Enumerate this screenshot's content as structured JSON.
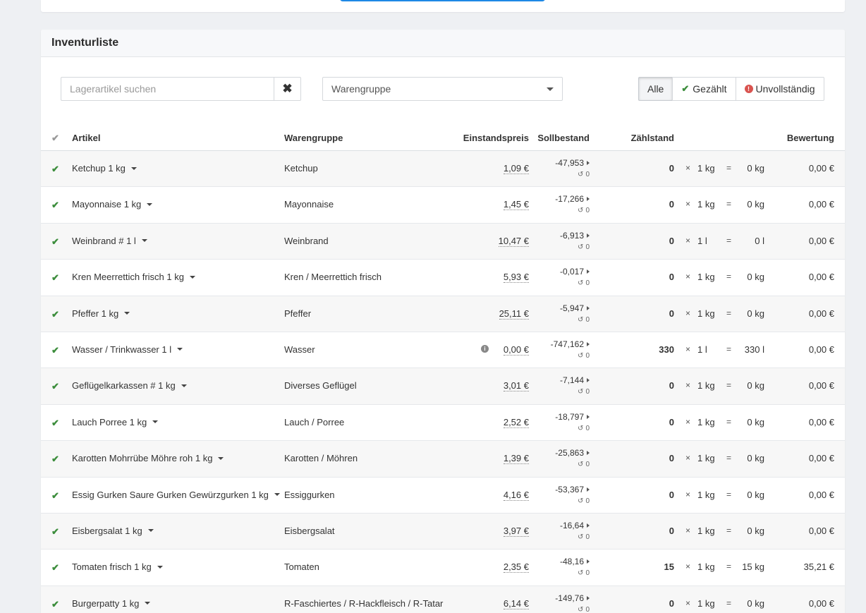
{
  "panel": {
    "title": "Inventurliste"
  },
  "search": {
    "placeholder": "Lagerartikel suchen",
    "value": ""
  },
  "group_select": {
    "label": "Warengruppe"
  },
  "filters": {
    "all": "Alle",
    "counted": "Gezählt",
    "incomplete": "Unvollständig",
    "active": "Alle"
  },
  "columns": {
    "article": "Artikel",
    "group": "Warengruppe",
    "price": "Einstandspreis",
    "target": "Sollbestand",
    "count": "Zählstand",
    "value": "Bewertung"
  },
  "rows": [
    {
      "article": "Ketchup 1 kg",
      "group": "Ketchup",
      "price": "1,09 €",
      "info": false,
      "target": "-47,953",
      "history": "0",
      "count": "0",
      "times": "×",
      "unit": "1 kg",
      "eq": "=",
      "total": "0 kg",
      "value": "0,00 €"
    },
    {
      "article": "Mayonnaise 1 kg",
      "group": "Mayonnaise",
      "price": "1,45 €",
      "info": false,
      "target": "-17,266",
      "history": "0",
      "count": "0",
      "times": "×",
      "unit": "1 kg",
      "eq": "=",
      "total": "0 kg",
      "value": "0,00 €"
    },
    {
      "article": "Weinbrand # 1 l",
      "group": "Weinbrand",
      "price": "10,47 €",
      "info": false,
      "target": "-6,913",
      "history": "0",
      "count": "0",
      "times": "×",
      "unit": "1 l",
      "eq": "=",
      "total": "0 l",
      "value": "0,00 €"
    },
    {
      "article": "Kren Meerrettich frisch 1 kg",
      "group": "Kren / Meerrettich frisch",
      "price": "5,93 €",
      "info": false,
      "target": "-0,017",
      "history": "0",
      "count": "0",
      "times": "×",
      "unit": "1 kg",
      "eq": "=",
      "total": "0 kg",
      "value": "0,00 €"
    },
    {
      "article": "Pfeffer 1 kg",
      "group": "Pfeffer",
      "price": "25,11 €",
      "info": false,
      "target": "-5,947",
      "history": "0",
      "count": "0",
      "times": "×",
      "unit": "1 kg",
      "eq": "=",
      "total": "0 kg",
      "value": "0,00 €"
    },
    {
      "article": "Wasser / Trinkwasser 1 l",
      "group": "Wasser",
      "price": "0,00 €",
      "info": true,
      "target": "-747,162",
      "history": "0",
      "count": "330",
      "times": "×",
      "unit": "1 l",
      "eq": "=",
      "total": "330 l",
      "value": "0,00 €"
    },
    {
      "article": "Geflügelkarkassen # 1 kg",
      "group": "Diverses Geflügel",
      "price": "3,01 €",
      "info": false,
      "target": "-7,144",
      "history": "0",
      "count": "0",
      "times": "×",
      "unit": "1 kg",
      "eq": "=",
      "total": "0 kg",
      "value": "0,00 €"
    },
    {
      "article": "Lauch Porree 1 kg",
      "group": "Lauch / Porree",
      "price": "2,52 €",
      "info": false,
      "target": "-18,797",
      "history": "0",
      "count": "0",
      "times": "×",
      "unit": "1 kg",
      "eq": "=",
      "total": "0 kg",
      "value": "0,00 €"
    },
    {
      "article": "Karotten Mohrrübe Möhre roh 1 kg",
      "group": "Karotten / Möhren",
      "price": "1,39 €",
      "info": false,
      "target": "-25,863",
      "history": "0",
      "count": "0",
      "times": "×",
      "unit": "1 kg",
      "eq": "=",
      "total": "0 kg",
      "value": "0,00 €"
    },
    {
      "article": "Essig Gurken Saure Gurken Gewürzgurken 1 kg",
      "group": "Essiggurken",
      "price": "4,16 €",
      "info": false,
      "target": "-53,367",
      "history": "0",
      "count": "0",
      "times": "×",
      "unit": "1 kg",
      "eq": "=",
      "total": "0 kg",
      "value": "0,00 €"
    },
    {
      "article": "Eisbergsalat 1 kg",
      "group": "Eisbergsalat",
      "price": "3,97 €",
      "info": false,
      "target": "-16,64",
      "history": "0",
      "count": "0",
      "times": "×",
      "unit": "1 kg",
      "eq": "=",
      "total": "0 kg",
      "value": "0,00 €"
    },
    {
      "article": "Tomaten frisch 1 kg",
      "group": "Tomaten",
      "price": "2,35 €",
      "info": false,
      "target": "-48,16",
      "history": "0",
      "count": "15",
      "times": "×",
      "unit": "1 kg",
      "eq": "=",
      "total": "15 kg",
      "value": "35,21 €"
    },
    {
      "article": "Burgerpatty 1 kg",
      "group": "R-Faschiertes / R-Hackfleisch / R-Tatar",
      "price": "6,14 €",
      "info": false,
      "target": "-149,76",
      "history": "0",
      "count": "0",
      "times": "×",
      "unit": "1 kg",
      "eq": "=",
      "total": "0 kg",
      "value": "0,00 €"
    }
  ]
}
